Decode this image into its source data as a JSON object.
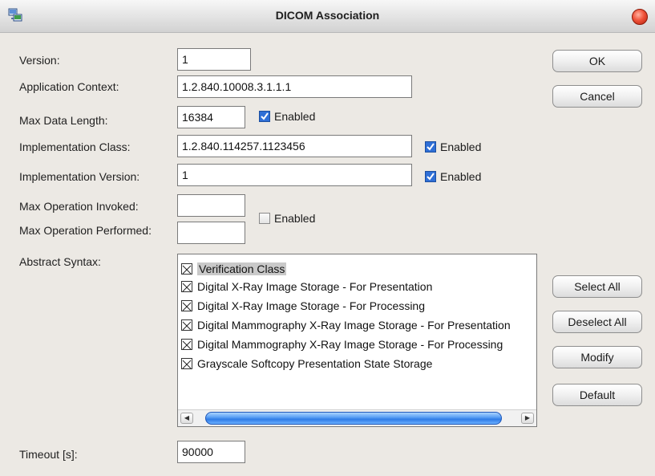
{
  "window": {
    "title": "DICOM Association"
  },
  "fields": {
    "version": {
      "label": "Version:",
      "value": "1"
    },
    "app_context": {
      "label": "Application Context:",
      "value": "1.2.840.10008.3.1.1.1"
    },
    "max_data_length": {
      "label": "Max Data Length:",
      "value": "16384",
      "enabled_label": "Enabled",
      "enabled": true
    },
    "impl_class": {
      "label": "Implementation Class:",
      "value": "1.2.840.114257.1123456",
      "enabled_label": "Enabled",
      "enabled": true
    },
    "impl_version": {
      "label": "Implementation Version:",
      "value": "1",
      "enabled_label": "Enabled",
      "enabled": true
    },
    "max_op_invoked": {
      "label": "Max Operation Invoked:",
      "value": ""
    },
    "max_op_performed": {
      "label": "Max Operation Performed:",
      "value": ""
    },
    "max_op_enabled": {
      "label": "Enabled",
      "enabled": false
    },
    "abstract_syntax": {
      "label": "Abstract Syntax:"
    },
    "timeout": {
      "label": "Timeout [s]:",
      "value": "90000"
    }
  },
  "abstract_syntax_items": [
    {
      "label": "Verification Class",
      "selected": true
    },
    {
      "label": "Digital X-Ray Image Storage - For Presentation",
      "selected": false
    },
    {
      "label": "Digital X-Ray Image Storage - For Processing",
      "selected": false
    },
    {
      "label": "Digital Mammography X-Ray Image Storage - For Presentation",
      "selected": false
    },
    {
      "label": "Digital Mammography X-Ray Image Storage - For Processing",
      "selected": false
    },
    {
      "label": "Grayscale Softcopy Presentation State Storage",
      "selected": false
    }
  ],
  "buttons": {
    "ok": "OK",
    "cancel": "Cancel",
    "select_all": "Select All",
    "deselect_all": "Deselect All",
    "modify": "Modify",
    "default": "Default"
  },
  "icons": {
    "app": "network-computer-icon",
    "close": "close-icon",
    "check": "check-icon",
    "x_box": "x-box-icon",
    "scroll_left": "scroll-left-arrow-icon",
    "scroll_right": "scroll-right-arrow-icon"
  },
  "colors": {
    "dialog_bg": "#ece9e4",
    "checkbox_checked": "#2f6fd6",
    "scroll_thumb": "#2f7be6",
    "close_button": "#f0533a"
  }
}
